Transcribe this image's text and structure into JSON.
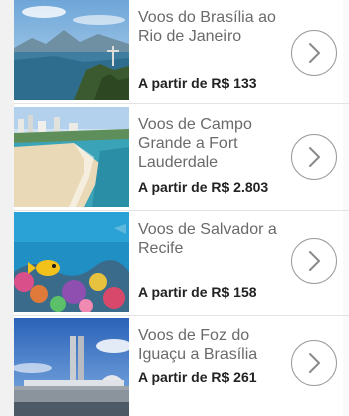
{
  "offers": [
    {
      "title": "Voos do Brasília ao Rio de Janeiro",
      "price": "A partir de R$ 133",
      "image_icon": "rio-de-janeiro-photo",
      "arrow_icon": "chevron-right-icon"
    },
    {
      "title": "Voos de Campo Grande a Fort Lauderdale",
      "price": "A partir de R$ 2.803",
      "image_icon": "fort-lauderdale-beach-photo",
      "arrow_icon": "chevron-right-icon"
    },
    {
      "title": "Voos de Salvador a Recife",
      "price": "A partir de R$ 158",
      "image_icon": "coral-reef-photo",
      "arrow_icon": "chevron-right-icon"
    },
    {
      "title": "Voos de Foz do Iguaçu a Brasília",
      "price": "A partir de R$ 261",
      "image_icon": "brasilia-congress-photo",
      "arrow_icon": "chevron-right-icon"
    }
  ],
  "colors": {
    "title": "#6a6a6a",
    "price": "#222222",
    "arrow_border": "#9a9a9a",
    "divider": "#e3e3e3"
  }
}
